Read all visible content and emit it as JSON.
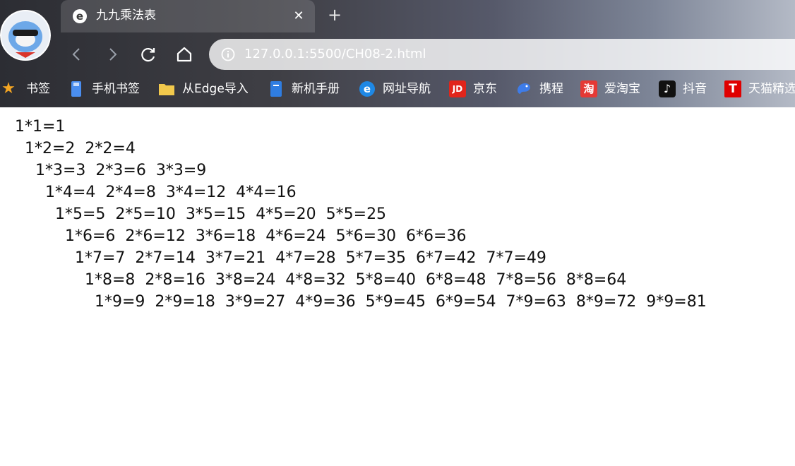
{
  "browser": {
    "tab_title": "九九乘法表",
    "tab_close": "✕",
    "new_tab": "+",
    "url": "127.0.0.1:5500/CH08-2.html"
  },
  "bookmarks": [
    {
      "label": "书签",
      "icon": "star-icon",
      "color": "#f5a623",
      "glyph": "★"
    },
    {
      "label": "手机书签",
      "icon": "phone-icon",
      "color": "#4a8ef0",
      "glyph": ""
    },
    {
      "label": "从Edge导入",
      "icon": "folder-icon",
      "color": "#f2c94c",
      "glyph": ""
    },
    {
      "label": "新机手册",
      "icon": "book-icon",
      "color": "#2f7de1",
      "glyph": ""
    },
    {
      "label": "网址导航",
      "icon": "edge-icon",
      "color": "#1e88e5",
      "glyph": "e"
    },
    {
      "label": "京东",
      "icon": "jd-icon",
      "color": "#e1251b",
      "glyph": "JD"
    },
    {
      "label": "携程",
      "icon": "ctrip-icon",
      "color": "#3e7ce8",
      "glyph": ""
    },
    {
      "label": "爱淘宝",
      "icon": "taobao-icon",
      "color": "#e53935",
      "glyph": "淘"
    },
    {
      "label": "抖音",
      "icon": "douyin-icon",
      "color": "#111111",
      "glyph": "♪"
    },
    {
      "label": "天猫精选",
      "icon": "tmall-icon",
      "color": "#e00000",
      "glyph": "T"
    }
  ],
  "table": [
    "1*1=1",
    "1*2=2  2*2=4",
    "1*3=3  2*3=6  3*3=9",
    "1*4=4  2*4=8  3*4=12  4*4=16",
    "1*5=5  2*5=10  3*5=15  4*5=20  5*5=25",
    "1*6=6  2*6=12  3*6=18  4*6=24  5*6=30  6*6=36",
    "1*7=7  2*7=14  3*7=21  4*7=28  5*7=35  6*7=42  7*7=49",
    "1*8=8  2*8=16  3*8=24  4*8=32  5*8=40  6*8=48  7*8=56  8*8=64",
    "1*9=9  2*9=18  3*9=27  4*9=36  5*9=45  6*9=54  7*9=63  8*9=72  9*9=81"
  ]
}
